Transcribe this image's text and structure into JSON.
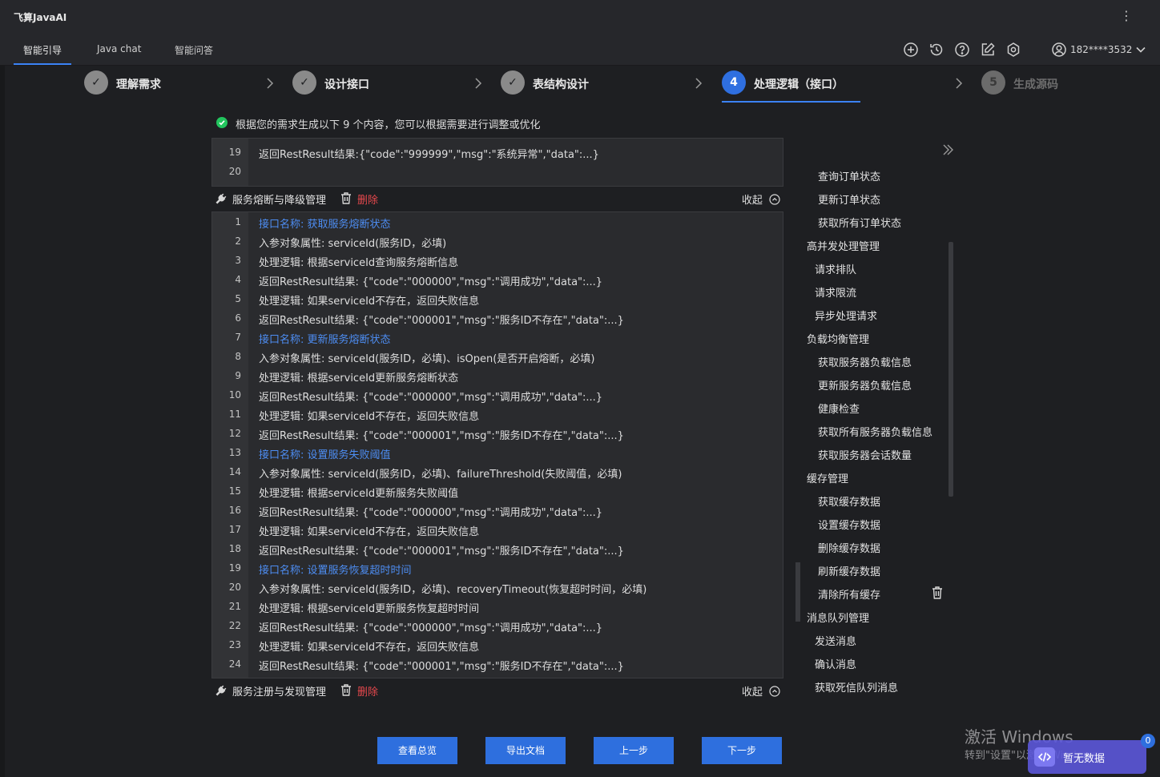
{
  "app": {
    "title": "飞算JavaAI",
    "menu_icon": "more-vertical-icon"
  },
  "tabs": [
    {
      "label": "智能引导",
      "active": true
    },
    {
      "label": "Java chat",
      "active": false
    },
    {
      "label": "智能问答",
      "active": false
    }
  ],
  "header_icons": [
    "add-circle-icon",
    "history-icon",
    "help-icon",
    "edit-icon",
    "settings-icon",
    "user-icon"
  ],
  "user": {
    "phone": "182****3532"
  },
  "steps": [
    {
      "marker": "✓",
      "label": "理解需求",
      "state": "done"
    },
    {
      "marker": "✓",
      "label": "设计接口",
      "state": "done"
    },
    {
      "marker": "✓",
      "label": "表结构设计",
      "state": "done"
    },
    {
      "marker": "4",
      "label": "处理逻辑（接口）",
      "state": "active"
    },
    {
      "marker": "5",
      "label": "生成源码",
      "state": "pending"
    }
  ],
  "notice": "根据您的需求生成以下 9 个内容，您可以根据需要进行调整或优化",
  "top_panel": {
    "lines": [
      {
        "n": "19",
        "text": "返回RestResult结果:{\"code\":\"999999\",\"msg\":\"系统异常\",\"data\":...}"
      },
      {
        "n": "20",
        "text": ""
      }
    ]
  },
  "section1": {
    "title": "服务熔断与降级管理",
    "delete": "删除",
    "collapse": "收起",
    "lines": [
      {
        "n": "1",
        "text": "接口名称: 获取服务熔断状态",
        "header": true
      },
      {
        "n": "2",
        "text": "入参对象属性: serviceId(服务ID，必填)"
      },
      {
        "n": "3",
        "text": "处理逻辑: 根据serviceId查询服务熔断信息"
      },
      {
        "n": "4",
        "text": "返回RestResult结果: {\"code\":\"000000\",\"msg\":\"调用成功\",\"data\":...}"
      },
      {
        "n": "5",
        "text": "处理逻辑: 如果serviceId不存在，返回失败信息"
      },
      {
        "n": "6",
        "text": "返回RestResult结果: {\"code\":\"000001\",\"msg\":\"服务ID不存在\",\"data\":...}"
      },
      {
        "n": "7",
        "text": "接口名称: 更新服务熔断状态",
        "header": true
      },
      {
        "n": "8",
        "text": "入参对象属性: serviceId(服务ID，必填)、isOpen(是否开启熔断，必填)"
      },
      {
        "n": "9",
        "text": "处理逻辑: 根据serviceId更新服务熔断状态"
      },
      {
        "n": "10",
        "text": "返回RestResult结果: {\"code\":\"000000\",\"msg\":\"调用成功\",\"data\":...}"
      },
      {
        "n": "11",
        "text": "处理逻辑: 如果serviceId不存在，返回失败信息"
      },
      {
        "n": "12",
        "text": "返回RestResult结果: {\"code\":\"000001\",\"msg\":\"服务ID不存在\",\"data\":...}"
      },
      {
        "n": "13",
        "text": "接口名称: 设置服务失败阈值",
        "header": true
      },
      {
        "n": "14",
        "text": "入参对象属性: serviceId(服务ID，必填)、failureThreshold(失败阈值，必填)"
      },
      {
        "n": "15",
        "text": "处理逻辑: 根据serviceId更新服务失败阈值"
      },
      {
        "n": "16",
        "text": "返回RestResult结果: {\"code\":\"000000\",\"msg\":\"调用成功\",\"data\":...}"
      },
      {
        "n": "17",
        "text": "处理逻辑: 如果serviceId不存在，返回失败信息"
      },
      {
        "n": "18",
        "text": "返回RestResult结果: {\"code\":\"000001\",\"msg\":\"服务ID不存在\",\"data\":...}"
      },
      {
        "n": "19",
        "text": "接口名称: 设置服务恢复超时时间",
        "header": true
      },
      {
        "n": "20",
        "text": "入参对象属性: serviceId(服务ID，必填)、recoveryTimeout(恢复超时时间，必填)"
      },
      {
        "n": "21",
        "text": "处理逻辑: 根据serviceId更新服务恢复超时时间"
      },
      {
        "n": "22",
        "text": "返回RestResult结果: {\"code\":\"000000\",\"msg\":\"调用成功\",\"data\":...}"
      },
      {
        "n": "23",
        "text": "处理逻辑: 如果serviceId不存在，返回失败信息"
      },
      {
        "n": "24",
        "text": "返回RestResult结果: {\"code\":\"000001\",\"msg\":\"服务ID不存在\",\"data\":...}"
      }
    ]
  },
  "section2": {
    "title": "服务注册与发现管理",
    "delete": "删除",
    "collapse": "收起"
  },
  "sidebar": {
    "items": [
      {
        "label": "查询订单状态",
        "level": 2
      },
      {
        "label": "更新订单状态",
        "level": 2
      },
      {
        "label": "获取所有订单状态",
        "level": 2
      },
      {
        "label": "高并发处理管理",
        "level": 1
      },
      {
        "label": "请求排队",
        "level": 2
      },
      {
        "label": "请求限流",
        "level": 2
      },
      {
        "label": "异步处理请求",
        "level": 2
      },
      {
        "label": "负载均衡管理",
        "level": 1
      },
      {
        "label": "获取服务器负载信息",
        "level": 2
      },
      {
        "label": "更新服务器负载信息",
        "level": 2
      },
      {
        "label": "健康检查",
        "level": 2
      },
      {
        "label": "获取所有服务器负载信息",
        "level": 2
      },
      {
        "label": "获取服务器会话数量",
        "level": 2
      },
      {
        "label": "缓存管理",
        "level": 1
      },
      {
        "label": "获取缓存数据",
        "level": 2
      },
      {
        "label": "设置缓存数据",
        "level": 2
      },
      {
        "label": "删除缓存数据",
        "level": 2
      },
      {
        "label": "刷新缓存数据",
        "level": 2
      },
      {
        "label": "清除所有缓存",
        "level": 2
      },
      {
        "label": "消息队列管理",
        "level": 1
      },
      {
        "label": "发送消息",
        "level": 2
      },
      {
        "label": "确认消息",
        "level": 2
      },
      {
        "label": "获取死信队列消息",
        "level": 2
      }
    ]
  },
  "buttons": {
    "overview": "查看总览",
    "export": "导出文档",
    "prev": "上一步",
    "next": "下一步"
  },
  "watermark": {
    "title": "激活 Windows",
    "subtitle": "转到\"设置\"以激活 Windows。"
  },
  "floating": {
    "text": "暂无数据",
    "count": "0"
  },
  "colors": {
    "accent": "#2e6fde",
    "header_link": "#4d8df2",
    "danger": "#e5484d",
    "success": "#22c55e"
  }
}
